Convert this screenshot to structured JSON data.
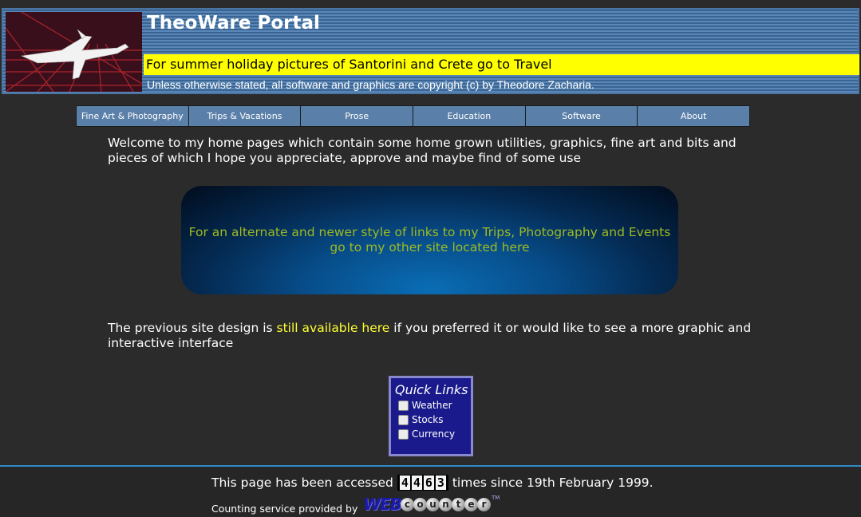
{
  "header": {
    "title": "TheoWare Portal",
    "banner": "For summer holiday pictures of Santorini and Crete go to Travel",
    "copyright": "Unless otherwise stated, all software and graphics are copyright (c) by Theodore Zacharia."
  },
  "nav": {
    "items": [
      {
        "label": "Fine Art & Photography"
      },
      {
        "label": "Trips & Vacations"
      },
      {
        "label": "Prose"
      },
      {
        "label": "Education"
      },
      {
        "label": "Software"
      },
      {
        "label": "About"
      }
    ]
  },
  "main": {
    "welcome": "Welcome to my home pages which contain some home grown utilities, graphics, fine art and bits and pieces of which I hope you appreciate, approve and maybe find of some use",
    "alt_link": "For an alternate and newer style of links to my Trips, Photography and Events go to my other site located here",
    "previous_before": "The previous site design is ",
    "previous_link": "still available here",
    "previous_after": " if you preferred it or would like to see a more graphic and interactive interface"
  },
  "quick_links": {
    "title": "Quick Links",
    "items": [
      {
        "label": "Weather"
      },
      {
        "label": "Stocks"
      },
      {
        "label": "Currency"
      }
    ]
  },
  "footer": {
    "counter_before": "This page has been accessed",
    "counter_digits": [
      "4",
      "4",
      "6",
      "3"
    ],
    "counter_after": "times since 19th February 1999.",
    "service": "Counting service provided by",
    "webcounter_web": "WEB",
    "webcounter_letters": [
      "c",
      "o",
      "u",
      "n",
      "t",
      "e",
      "r"
    ],
    "webcounter_tm": "TM"
  },
  "colors": {
    "banner_bg": "#ffff00",
    "nav_bg": "#5a7fa8",
    "alt_text": "#9dba22",
    "link": "#ffff33",
    "quick_bg": "#1a1a8c",
    "divider": "#2e8bc4"
  },
  "icons": {
    "logo": "fighter-jet-logo",
    "checkbox": "checkbox-icon"
  }
}
